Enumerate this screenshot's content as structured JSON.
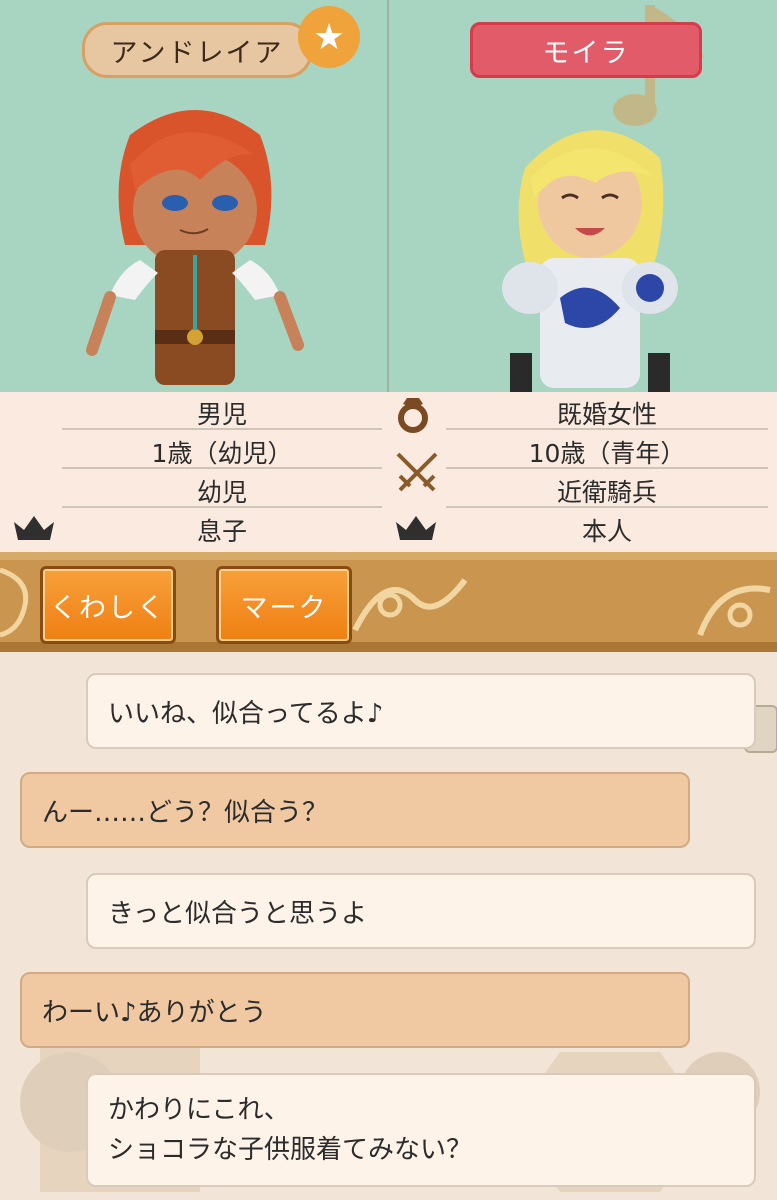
{
  "characters": {
    "left": {
      "name": "アンドレイア",
      "favorite_icon": "star-icon"
    },
    "right": {
      "name": "モイラ"
    }
  },
  "info": {
    "left": {
      "gender": "男児",
      "age": "1歳（幼児）",
      "job": "幼児",
      "relation": "息子"
    },
    "right": {
      "gender": "既婚女性",
      "age": "10歳（青年）",
      "job": "近衛騎兵",
      "relation": "本人"
    }
  },
  "buttons": {
    "details": "くわしく",
    "mark": "マーク"
  },
  "chat": [
    {
      "side": "right",
      "text": "いいね、似合ってるよ♪"
    },
    {
      "side": "left",
      "text": "んー……どう？似合う？"
    },
    {
      "side": "right",
      "text": "きっと似合うと思うよ"
    },
    {
      "side": "left",
      "text": "わーい♪ありがとう"
    },
    {
      "side": "right",
      "line1": "かわりにこれ、",
      "line2": "ショコラな子供服着てみない？"
    }
  ],
  "icons": [
    "star-icon",
    "ring-icon",
    "crossed-swords-icon",
    "crown-icon",
    "music-note-icon"
  ],
  "colors": {
    "accent_orange": "#ef7f12",
    "portrait_bg": "#a8d4c2",
    "name_red": "#e15b69"
  }
}
